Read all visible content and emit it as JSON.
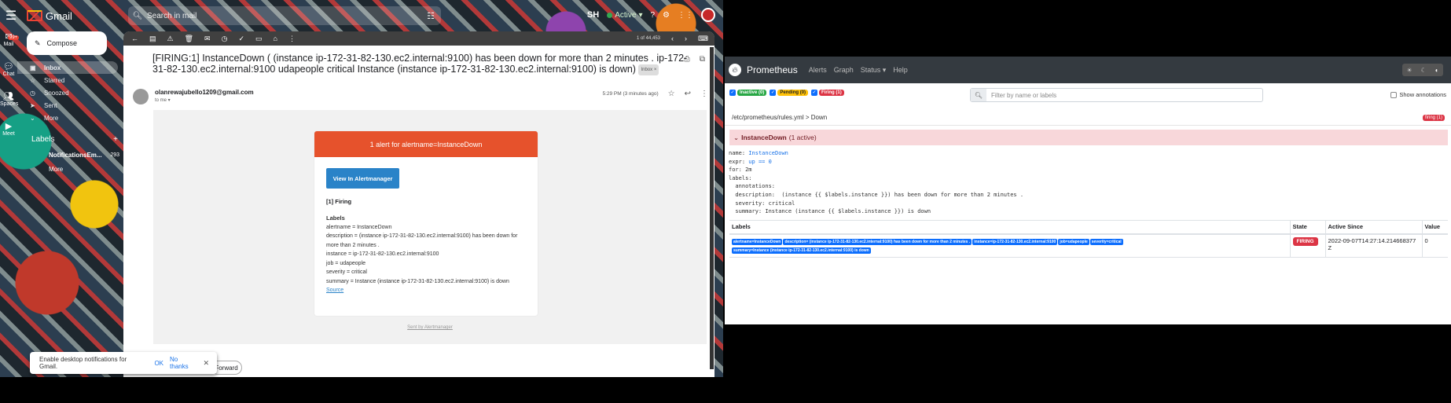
{
  "gmail": {
    "app_name": "Gmail",
    "search_placeholder": "Search in mail",
    "avatar_initials": "SH",
    "status": "Active",
    "rail": {
      "mail": "Mail",
      "mail_badge": "99+",
      "chat": "Chat",
      "spaces": "Spaces",
      "meet": "Meet"
    },
    "compose": "Compose",
    "nav": [
      {
        "label": "Inbox",
        "count": ""
      },
      {
        "label": "Starred",
        "count": ""
      },
      {
        "label": "Snoozed",
        "count": ""
      },
      {
        "label": "Sent",
        "count": ""
      },
      {
        "label": "More",
        "count": ""
      }
    ],
    "labels_header": "Labels",
    "labels": [
      {
        "label": "NotificationsEm...",
        "count": "293"
      }
    ],
    "labels_more": "More",
    "pager": "1 of 44,453",
    "subject": "[FIRING:1] InstanceDown ( (instance ip-172-31-82-130.ec2.internal:9100) has been down for more than 2 minutes . ip-172-31-82-130.ec2.internal:9100 udapeople critical Instance (instance ip-172-31-82-130.ec2.internal:9100) is down)",
    "inbox_chip": "Inbox ×",
    "sender": "olanrewajubello1209@gmail.com",
    "to": "to me ▾",
    "time": "5:29 PM (3 minutes ago)",
    "alert_header": "1 alert for alertname=InstanceDown",
    "view_button": "View In Alertmanager",
    "firing_title": "[1] Firing",
    "labels_title": "Labels",
    "alert_lines": [
      "alertname = InstanceDown",
      "description = (instance ip-172-31-82-130.ec2.internal:9100) has been down for more than 2 minutes .",
      "instance = ip-172-31-82-130.ec2.internal:9100",
      "job = udapeople",
      "severity = critical",
      "summary = Instance (instance ip-172-31-82-130.ec2.internal:9100) is down"
    ],
    "source_link": "Source",
    "sent_by": "Sent by Alertmanager",
    "notification": {
      "text": "Enable desktop notifications for Gmail.",
      "ok": "OK",
      "no": "No thanks"
    },
    "forward": "Forward"
  },
  "prometheus": {
    "brand": "Prometheus",
    "nav": [
      "Alerts",
      "Graph",
      "Status ▾",
      "Help"
    ],
    "filters": {
      "inactive": "Inactive (0)",
      "pending": "Pending (0)",
      "firing": "Firing (1)"
    },
    "search_placeholder": "Filter by name or labels",
    "show_annotations": "Show annotations",
    "group_path": "/etc/prometheus/rules.yml > Down",
    "group_badge": "firing (1)",
    "rule_name": "InstanceDown",
    "rule_active": "(1 active)",
    "yaml": {
      "name_key": "name: ",
      "name_val": "InstanceDown",
      "expr_key": "expr: ",
      "expr_val": "up == 0",
      "for_line": "for: 2m",
      "labels_line": "labels:",
      "annotations_line": "  annotations:",
      "description_line": "  description:  (instance {{ $labels.instance }}) has been down for more than 2 minutes .",
      "severity_line": "  severity: critical",
      "summary_line": "  summary: Instance (instance {{ $labels.instance }}) is down"
    },
    "table": {
      "headers": [
        "Labels",
        "State",
        "Active Since",
        "Value"
      ],
      "labels": [
        "alertname=InstanceDown",
        "description= (instance ip-172-31-82-130.ec2.internal:9100) has been down for more than 2 minutes .",
        "instance=ip-172-31-82-130.ec2.internal:9100",
        "job=udapeople",
        "severity=critical",
        "summary=Instance (instance ip-172-31-82-130.ec2.internal:9100) is down"
      ],
      "state": "FIRING",
      "active_since": "2022-09-07T14:27:14.214668377Z",
      "value": "0"
    }
  },
  "colors": {
    "prom_nav": "#343a40",
    "firing": "#dc3545",
    "alert_orange": "#e6522c",
    "link_blue": "#2a83c8"
  }
}
